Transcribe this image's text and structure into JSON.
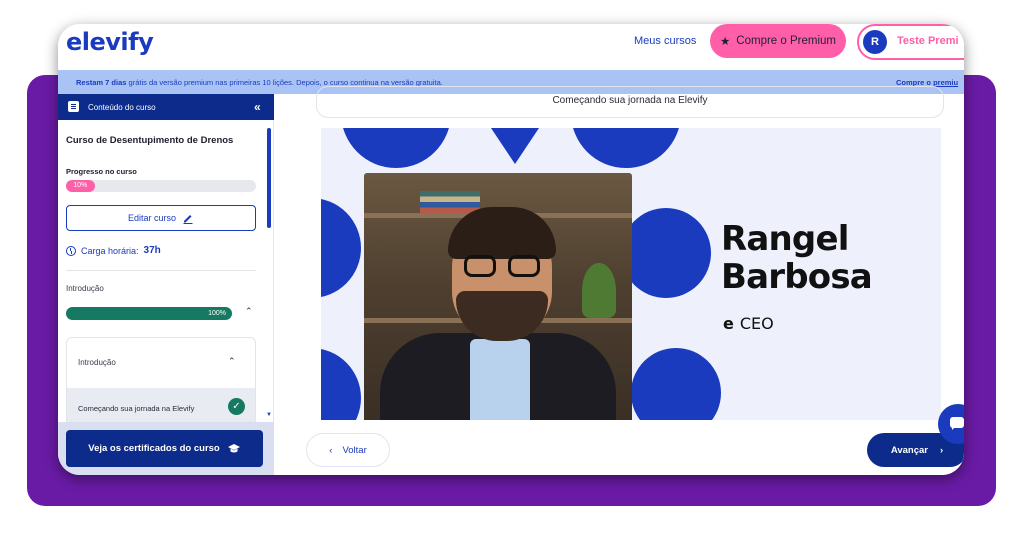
{
  "header": {
    "logo": "elevify",
    "nav_my_courses": "Meus cursos",
    "premium_button": "Compre o Premium",
    "user_initial": "R",
    "user_name": "Teste Premi"
  },
  "banner": {
    "text_bold": "Restam 7 dias",
    "text_rest": " grátis da versão premium nas primeiras 10 lições. Depois, o curso continua na versão gratuita.",
    "link": "Compre o premiu"
  },
  "sidebar": {
    "header_label": "Conteúdo do curso",
    "collapse_glyph": "«",
    "course_title": "Curso de Desentupimento de Drenos",
    "progress_label": "Progresso no curso",
    "progress_value": "10%",
    "progress_fraction": 0.1,
    "edit_button": "Editar curso",
    "workload_label": "Carga horária:",
    "workload_value": "37h",
    "section_label": "Introdução",
    "section_progress": "100%",
    "section_fraction": 1.0,
    "lesson_group": "Introdução",
    "lesson_item": "Começando sua jornada na Elevify",
    "certificates_button": "Veja os certificados do curso"
  },
  "main": {
    "lesson_title": "Começando sua jornada na Elevify",
    "presenter_first": "Rangel",
    "presenter_last": "Barbosa",
    "presenter_role": "CEO",
    "role_glyph": "e",
    "back_button": "Voltar",
    "next_button": "Avançar"
  },
  "colors": {
    "brand_blue": "#1b3bbf",
    "navy": "#0d2b8a",
    "pink": "#ff5fa8",
    "green": "#167a63",
    "purple_bg": "#6a1ba6"
  }
}
